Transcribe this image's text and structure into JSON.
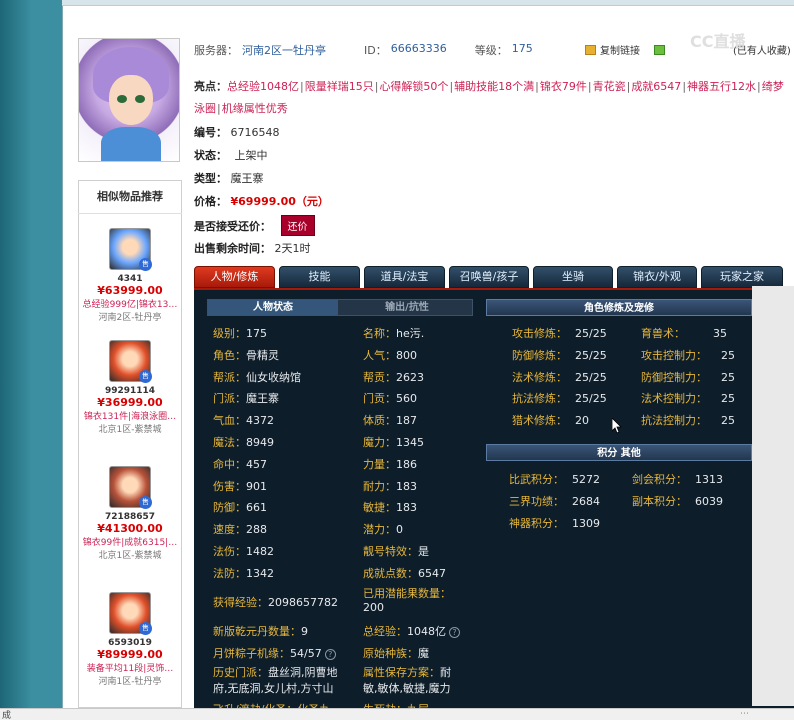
{
  "header": {
    "server_label": "服务器：",
    "server_value": "河南2区一牡丹亭",
    "id_label": "ID：",
    "id_value": "66663336",
    "level_label": "等级：",
    "level_value": "175",
    "copy_link": "复制链接",
    "favorite_tail": "(已有人收藏)"
  },
  "highlights": {
    "label": "亮点：",
    "items": [
      "总经验1048亿",
      "限量祥瑞15只",
      "心得解锁50个",
      "辅助技能18个满",
      "锦衣79件",
      "青花瓷",
      "成就6547",
      "神器五行12水",
      "绮梦泳圈",
      "机缘属性优秀"
    ]
  },
  "info": {
    "number_label": "编号：",
    "number_value": "6716548",
    "status_label": "状态：",
    "status_value": "上架中",
    "type_label": "类型：",
    "type_value": "魔王寨",
    "price_label": "价格：",
    "price_value": "¥69999.00（元）",
    "bargain_label": "是否接受还价：",
    "bargain_button": "还价",
    "remaining_label": "出售剩余时间：",
    "remaining_value": "2天1时"
  },
  "similar": {
    "title": "相似物品推荐",
    "items": [
      {
        "id": "4341",
        "price": "¥63999.00",
        "desc": "总经验999亿|锦衣13…",
        "server": "河南2区-牡丹亭",
        "color": "#6aa6ff"
      },
      {
        "id": "99291114",
        "price": "¥36999.00",
        "desc": "锦衣131件|海浪泳圈…",
        "server": "北京1区-紫禁城",
        "color": "#e0502a"
      },
      {
        "id": "72188657",
        "price": "¥41300.00",
        "desc": "锦衣99件|成就6315|…",
        "server": "北京1区-紫禁城",
        "color": "#b8523a"
      },
      {
        "id": "6593019",
        "price": "¥89999.00",
        "desc": "装备平均11段|灵饰…",
        "server": "河南1区-牡丹亭",
        "color": "#e0502a"
      }
    ],
    "tag": "售"
  },
  "tabs": [
    "人物/修炼",
    "技能",
    "道具/法宝",
    "召唤兽/孩子",
    "坐骑",
    "锦衣/外观",
    "玩家之家"
  ],
  "subtabs": [
    "人物状态",
    "输出/抗性"
  ],
  "sections": {
    "cultivation": "角色修炼及宠修",
    "points": "积分 其他"
  },
  "stats_left": [
    {
      "label": "级别：",
      "value": "175"
    },
    {
      "label": "角色：",
      "value": "骨精灵"
    },
    {
      "label": "帮派：",
      "value": "仙女收纳馆"
    },
    {
      "label": "门派：",
      "value": "魔王寨"
    },
    {
      "label": "气血：",
      "value": "4372"
    },
    {
      "label": "魔法：",
      "value": "8949"
    },
    {
      "label": "命中：",
      "value": "457"
    },
    {
      "label": "伤害：",
      "value": "901"
    },
    {
      "label": "防御：",
      "value": "661"
    },
    {
      "label": "速度：",
      "value": "288"
    },
    {
      "label": "法伤：",
      "value": "1482"
    },
    {
      "label": "法防：",
      "value": "1342"
    }
  ],
  "stats_mid": [
    {
      "label": "名称：",
      "value": "he污."
    },
    {
      "label": "人气：",
      "value": "800"
    },
    {
      "label": "帮贡：",
      "value": "2623"
    },
    {
      "label": "门贡：",
      "value": "560"
    },
    {
      "label": "体质：",
      "value": "187"
    },
    {
      "label": "魔力：",
      "value": "1345"
    },
    {
      "label": "力量：",
      "value": "186"
    },
    {
      "label": "耐力：",
      "value": "183"
    },
    {
      "label": "敏捷：",
      "value": "183"
    },
    {
      "label": "潜力：",
      "value": "0"
    },
    {
      "label": "靓号特效：",
      "value": "是"
    },
    {
      "label": "成就点数：",
      "value": "6547"
    }
  ],
  "extra": {
    "exp_label": "获得经验：",
    "exp_value": "2098657782",
    "potential_label": "已用潜能果数量：",
    "potential_value": "200",
    "qianyuan_label": "新版乾元丹数量：",
    "qianyuan_value": "9",
    "total_exp_label": "总经验：",
    "total_exp_value": "1048亿",
    "zongzi_label": "月饼粽子机缘：",
    "zongzi_value": "54/57",
    "race_label": "原始种族：",
    "race_value": "魔",
    "history_label": "历史门派：",
    "history_value_1": "盘丝洞,阴曹地",
    "history_value_2": "府,无底洞,女儿村,方寸山",
    "save_label": "属性保存方案：",
    "save_value_1": "耐",
    "save_value_2": "敏,敏体,敏捷,魔力",
    "cut_row_left": "飞升/渡劫/化圣：化圣九",
    "cut_row_right": "生死劫：九层"
  },
  "cultivation": [
    {
      "label": "攻击修炼：",
      "value": "25/25",
      "label2": "育兽术：",
      "value2": "35"
    },
    {
      "label": "防御修炼：",
      "value": "25/25",
      "label2": "攻击控制力：",
      "value2": "25"
    },
    {
      "label": "法术修炼：",
      "value": "25/25",
      "label2": "防御控制力：",
      "value2": "25"
    },
    {
      "label": "抗法修炼：",
      "value": "25/25",
      "label2": "法术控制力：",
      "value2": "25"
    },
    {
      "label": "猎术修炼：",
      "value": "20",
      "label2": "抗法控制力：",
      "value2": "25"
    }
  ],
  "points": [
    {
      "label": "比武积分：",
      "value": "5272",
      "label2": "剑会积分：",
      "value2": "1313"
    },
    {
      "label": "三界功绩：",
      "value": "2684",
      "label2": "副本积分：",
      "value2": "6039"
    },
    {
      "label": "神器积分：",
      "value": "1309",
      "label2": "",
      "value2": ""
    }
  ],
  "status_bar": {
    "text": "成"
  },
  "watermark": "CC直播"
}
